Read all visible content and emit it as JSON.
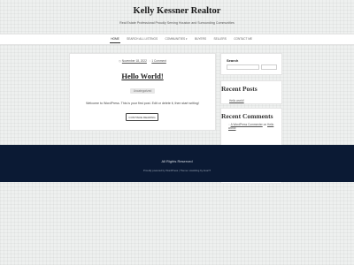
{
  "site": {
    "title": "Kelly Kessner Realtor",
    "tagline": "Real Estate Professional Proudly Serving Houston and Surrounding Communities"
  },
  "nav": {
    "items": [
      {
        "label": "Home"
      },
      {
        "label": "Search All Listings"
      },
      {
        "label": "Communities ▾"
      },
      {
        "label": "Buyers"
      },
      {
        "label": "Sellers"
      },
      {
        "label": "Contact Me"
      }
    ]
  },
  "post": {
    "date": "November 18, 2022",
    "comments": "1 Comment",
    "title": "Hello World!",
    "category": "Uncategorized",
    "excerpt": "Welcome to WordPress. This is your first post. Edit or delete it, then start writing!",
    "more": "Continue Reading"
  },
  "sidebar": {
    "search_title": "Search",
    "recent_posts_title": "Recent Posts",
    "recent_posts": [
      "Hello world!"
    ],
    "recent_comments_title": "Recent Comments",
    "comment_author": "A WordPress Commenter",
    "comment_on": " on ",
    "comment_post": "Hello world!"
  },
  "footer": {
    "rights": "All Rights Reserved",
    "credits": "Proudly powered by WordPress   |   Theme: Hostitting by AnarIT"
  }
}
